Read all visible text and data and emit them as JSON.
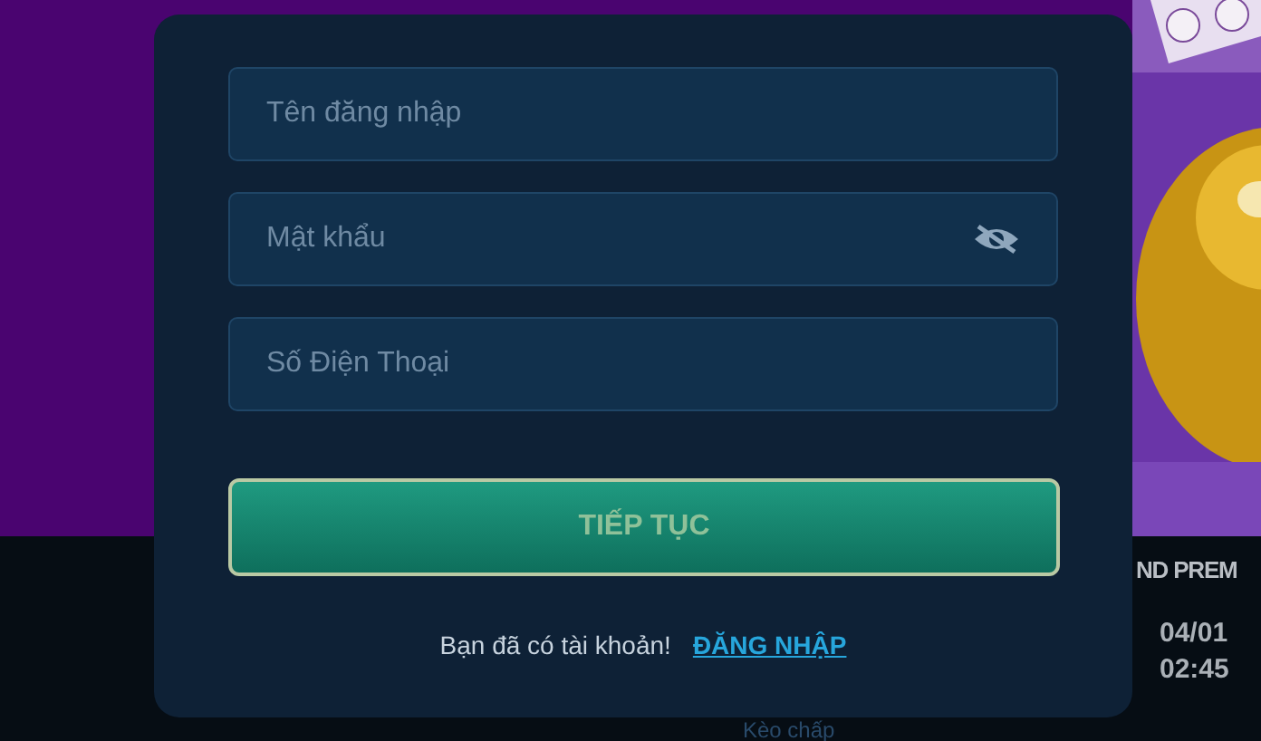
{
  "background": {
    "heading": "ND PREM",
    "date": "04/01",
    "time": "02:45",
    "tab": "Kèo chấp"
  },
  "form": {
    "fields": [
      {
        "placeholder": "Tên đăng nhập",
        "kind": "text"
      },
      {
        "placeholder": "Mật khẩu",
        "kind": "password"
      },
      {
        "placeholder": "Số Điện Thoại",
        "kind": "text"
      }
    ],
    "submit": "TIẾP TỤC",
    "prompt": "Bạn đã có tài khoản!",
    "link": "ĐĂNG NHẬP"
  }
}
